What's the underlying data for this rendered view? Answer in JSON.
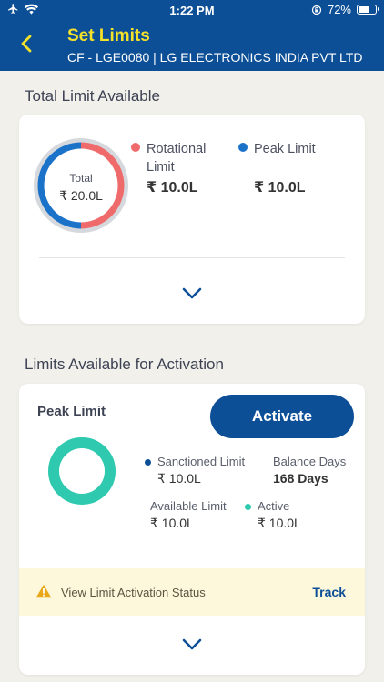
{
  "status_bar": {
    "time": "1:22 PM",
    "battery": "72%",
    "battery_level": 0.72
  },
  "header": {
    "title": "Set Limits",
    "subtitle": "CF -  LGE0080 | LG ELECTRONICS INDIA PVT LTD"
  },
  "total_limit": {
    "section_title": "Total Limit Available",
    "donut": {
      "label": "Total",
      "value": "₹ 20.0L"
    },
    "rotational": {
      "label": "Rotational Limit",
      "amount": "₹ 10.0L",
      "color": "#ef6b6b"
    },
    "peak": {
      "label": "Peak Limit",
      "amount": "₹ 10.0L",
      "color": "#1a73c9"
    }
  },
  "activation": {
    "section_title": "Limits Available for Activation",
    "card_title": "Peak Limit",
    "activate_label": "Activate",
    "sanctioned": {
      "label": "Sanctioned Limit",
      "amount": "₹ 10.0L",
      "color": "#0c4f97"
    },
    "balance_days": {
      "label": "Balance Days",
      "value": "168 Days"
    },
    "available": {
      "label": "Available Limit",
      "amount": "₹ 10.0L"
    },
    "active": {
      "label": "Active",
      "amount": "₹ 10.0L",
      "color": "#2ec9ae"
    },
    "track_message": "View Limit Activation Status",
    "track_label": "Track"
  },
  "colors": {
    "brand_blue": "#0c4f97",
    "title_yellow": "#f4e12a",
    "rotational_red": "#ef6b6b",
    "peak_blue": "#1a73c9",
    "active_teal": "#2ec9ae",
    "warning_bg": "#fdf8dc"
  }
}
